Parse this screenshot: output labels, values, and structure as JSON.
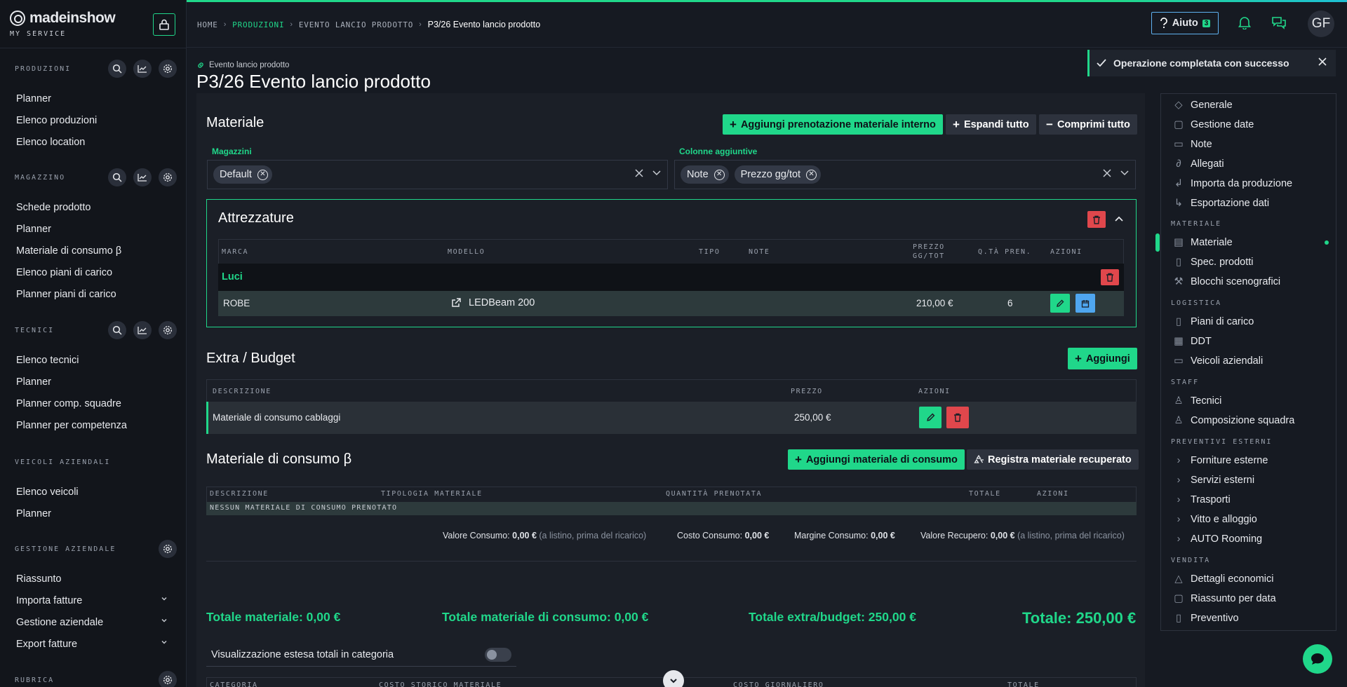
{
  "brand": {
    "name": "madeinshow",
    "subtitle": "MY SERVICE"
  },
  "sidebar": {
    "sections": [
      {
        "title": "PRODUZIONI",
        "items": [
          "Planner",
          "Elenco produzioni",
          "Elenco location"
        ]
      },
      {
        "title": "MAGAZZINO",
        "items": [
          "Schede prodotto",
          "Planner",
          "Materiale di consumo β",
          "Elenco piani di carico",
          "Planner piani di carico"
        ]
      },
      {
        "title": "TECNICI",
        "items": [
          "Elenco tecnici",
          "Planner",
          "Planner comp. squadre",
          "Planner per competenza"
        ]
      },
      {
        "title": "VEICOLI AZIENDALI",
        "items": [
          "Elenco veicoli",
          "Planner"
        ]
      },
      {
        "title": "GESTIONE AZIENDALE",
        "items": [
          "Riassunto",
          "Importa fatture",
          "Gestione aziendale",
          "Export fatture"
        ]
      },
      {
        "title": "RUBRICA",
        "items": []
      }
    ]
  },
  "breadcrumb": [
    "HOME",
    "PRODUZIONI",
    "EVENTO LANCIO PRODOTTO",
    "P3/26 Evento lancio prodotto"
  ],
  "topbar": {
    "help_label": "Aiuto",
    "help_count": "3",
    "avatar_initials": "GF"
  },
  "page": {
    "crumb": "Evento lancio prodotto",
    "title": "P3/26 Evento lancio prodotto"
  },
  "toast": {
    "message": "Operazione completata con successo"
  },
  "materiale": {
    "title": "Materiale",
    "btn_add_internal": "Aggiungi prenotazione materiale interno",
    "btn_expand": "Espandi tutto",
    "btn_collapse": "Comprimi tutto",
    "magazzini_label": "Magazzini",
    "magazzini_chips": [
      "Default"
    ],
    "colonne_label": "Colonne aggiuntive",
    "colonne_chips": [
      "Note",
      "Prezzo gg/tot"
    ]
  },
  "attrezzature": {
    "title": "Attrezzature",
    "headers": {
      "marca": "MARCA",
      "modello": "MODELLO",
      "tipo": "TIPO",
      "note": "NOTE",
      "prezzo1": "PREZZO",
      "prezzo2": "GG/TOT",
      "qta": "Q.TÀ PREN.",
      "azioni": "AZIONI"
    },
    "group": "Luci",
    "row": {
      "marca": "ROBE",
      "modello": "LEDBeam 200",
      "prezzo": "210,00 €",
      "qta": "6"
    }
  },
  "extra": {
    "title": "Extra / Budget",
    "btn_add": "Aggiungi",
    "headers": {
      "descrizione": "DESCRIZIONE",
      "prezzo": "PREZZO",
      "azioni": "AZIONI"
    },
    "row": {
      "descrizione": "Materiale di consumo cablaggi",
      "prezzo": "250,00 €"
    }
  },
  "consumo": {
    "title": "Materiale di consumo β",
    "btn_add": "Aggiungi materiale di consumo",
    "btn_recover": "Registra materiale recuperato",
    "headers": {
      "descrizione": "DESCRIZIONE",
      "tipologia": "TIPOLOGIA MATERIALE",
      "quantita": "QUANTITÀ PRENOTATA",
      "totale": "TOTALE",
      "azioni": "AZIONI"
    },
    "empty": "NESSUN MATERIALE DI CONSUMO PRENOTATO",
    "summary": {
      "valore_label": "Valore Consumo:",
      "valore": "0,00 €",
      "valore_note": "(a listino, prima del ricarico)",
      "costo_label": "Costo Consumo:",
      "costo": "0,00 €",
      "margine_label": "Margine Consumo:",
      "margine": "0,00 €",
      "recupero_label": "Valore Recupero:",
      "recupero": "0,00 €",
      "recupero_note": "(a listino, prima del ricarico)"
    }
  },
  "totals": {
    "materiale": "Totale materiale: 0,00 €",
    "consumo": "Totale materiale di consumo: 0,00 €",
    "extra": "Totale extra/budget: 250,00 €",
    "totale": "Totale: 250,00 €",
    "toggle_label": "Visualizzazione estesa totali in categoria"
  },
  "bottom_headers": {
    "categoria": "CATEGORIA",
    "costo_storico": "COSTO STORICO MATERIALE",
    "costo_giornaliero": "COSTO GIORNALIERO",
    "totale": "TOTALE"
  },
  "right_nav": {
    "group1": [
      "Generale",
      "Gestione date",
      "Note",
      "Allegati",
      "Importa da produzione",
      "Esportazione dati"
    ],
    "materiale_head": "MATERIALE",
    "materiale": [
      "Materiale",
      "Spec. prodotti",
      "Blocchi scenografici"
    ],
    "logistica_head": "LOGISTICA",
    "logistica": [
      "Piani di carico",
      "DDT",
      "Veicoli aziendali"
    ],
    "staff_head": "STAFF",
    "staff": [
      "Tecnici",
      "Composizione squadra"
    ],
    "preventivi_head": "PREVENTIVI ESTERNI",
    "preventivi": [
      "Forniture esterne",
      "Servizi esterni",
      "Trasporti",
      "Vitto e alloggio",
      "AUTO Rooming"
    ],
    "vendita_head": "VENDITA",
    "vendita": [
      "Dettagli economici",
      "Riassunto per data",
      "Preventivo"
    ]
  },
  "colors": {
    "accent": "#20d78a",
    "danger": "#e0474c",
    "info": "#4fa6ef",
    "background": "#161a22"
  }
}
